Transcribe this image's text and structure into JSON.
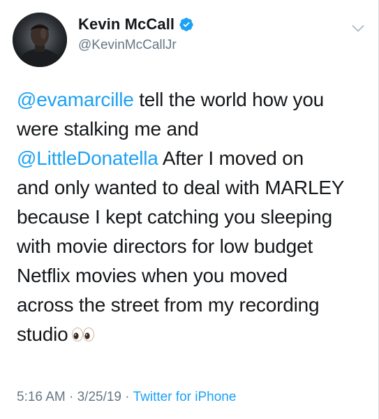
{
  "user": {
    "display_name": "Kevin McCall",
    "handle": "@KevinMcCallJr",
    "verified": true,
    "avatar_icon": "user-avatar-photo"
  },
  "tweet": {
    "lines": [
      [
        {
          "text": "@evamarcille",
          "mention": true
        },
        {
          "text": " tell the world how you",
          "mention": false
        }
      ],
      [
        {
          "text": "were stalking  me and",
          "mention": false
        }
      ],
      [
        {
          "text": "@LittleDonatella",
          "mention": true
        },
        {
          "text": "   After I moved on",
          "mention": false
        }
      ],
      [
        {
          "text": "and only wanted to deal with MARLEY",
          "mention": false
        }
      ],
      [
        {
          "text": "because I kept catching you sleeping",
          "mention": false
        }
      ],
      [
        {
          "text": "with movie directors for low budget",
          "mention": false
        }
      ],
      [
        {
          "text": "Netflix movies  when you moved",
          "mention": false
        }
      ],
      [
        {
          "text": "across the street from my recording",
          "mention": false
        }
      ],
      [
        {
          "text": "studio",
          "mention": false
        }
      ]
    ],
    "trailing_emoji": "eyes-icon"
  },
  "meta": {
    "time": "5:16 AM",
    "separator": " · ",
    "date": "3/25/19",
    "source": "Twitter for iPhone"
  },
  "colors": {
    "link": "#1da1f2",
    "text": "#14171a",
    "secondary": "#657786"
  }
}
